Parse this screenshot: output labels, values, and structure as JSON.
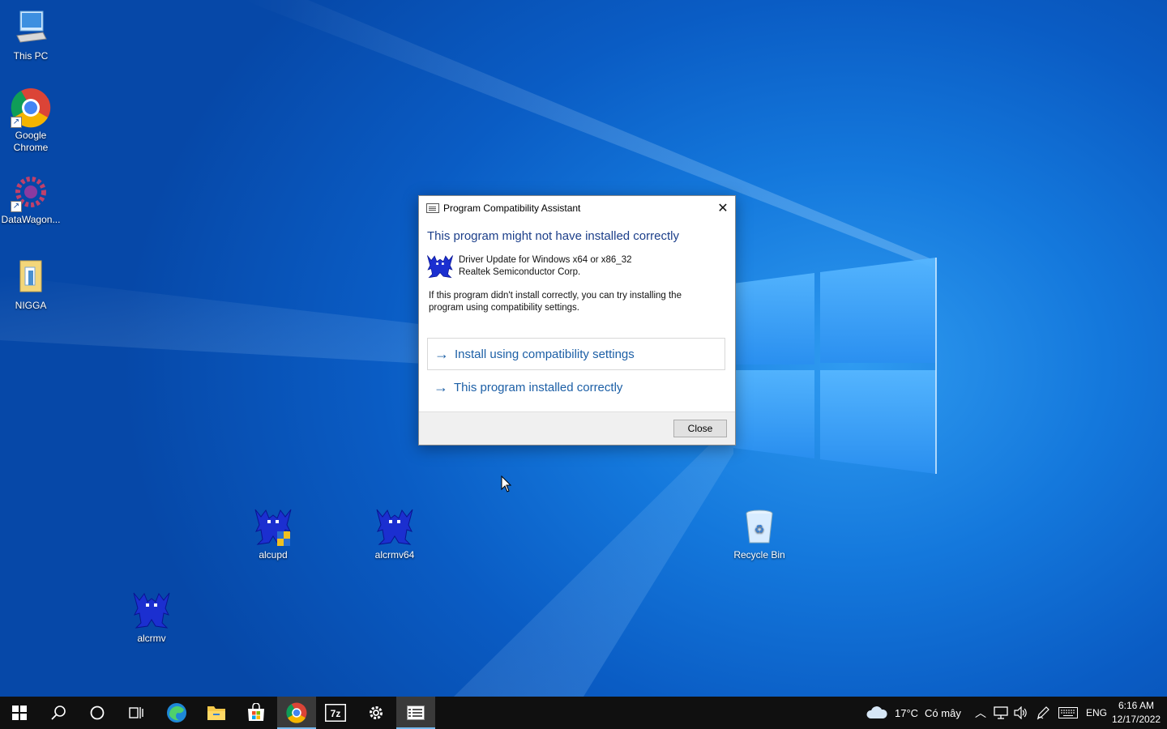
{
  "desktop": {
    "icons": [
      {
        "label": "This PC",
        "icon": "this-pc-icon"
      },
      {
        "label": "Google Chrome",
        "icon": "chrome-icon"
      },
      {
        "label": "DataWagon...",
        "icon": "datawagon-icon"
      },
      {
        "label": "NIGGA",
        "icon": "folder-icon"
      },
      {
        "label": "alcupd",
        "icon": "realtek-icon"
      },
      {
        "label": "alcrmv64",
        "icon": "realtek-icon"
      },
      {
        "label": "Recycle Bin",
        "icon": "recycle-bin-icon"
      },
      {
        "label": "alcrmv",
        "icon": "realtek-icon"
      }
    ]
  },
  "dialog": {
    "title": "Program Compatibility Assistant",
    "heading": "This program might not have installed correctly",
    "program_name": "Driver Update for Windows x64 or x86_32",
    "publisher": "Realtek Semiconductor Corp.",
    "message": "If this program didn't install correctly, you can try installing the program using compatibility settings.",
    "option_install": "Install using compatibility settings",
    "option_correct": "This program installed correctly",
    "close_button": "Close",
    "heading_color": "#1c3f8a",
    "link_color": "#1c5fa6"
  },
  "taskbar": {
    "apps": [
      "start-icon",
      "search-icon",
      "cortana-icon",
      "task-view-icon",
      "edge-icon",
      "file-explorer-icon",
      "store-icon",
      "chrome-icon",
      "7zip-icon",
      "settings-icon",
      "compat-assistant-icon"
    ],
    "weather_temp": "17°C",
    "weather_desc": "Có mây",
    "language": "ENG",
    "time": "6:16 AM",
    "date": "12/17/2022"
  }
}
